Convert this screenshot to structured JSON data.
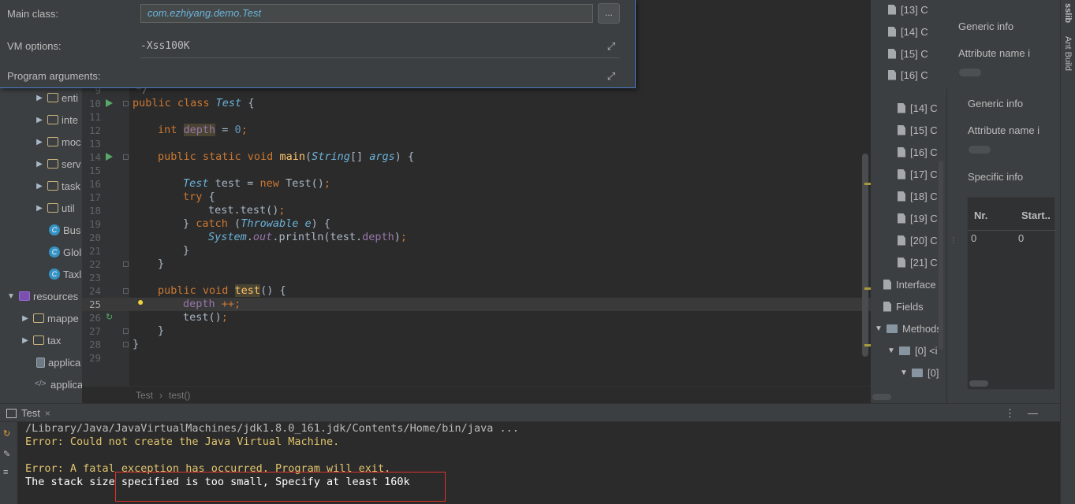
{
  "dialog": {
    "main_class_label": "Main class:",
    "main_class_value": "com.ezhiyang.demo.Test",
    "browse_label": "...",
    "vm_options_label": "VM options:",
    "vm_options_value": "-Xss100K",
    "program_args_label": "Program arguments:"
  },
  "project_tree": {
    "items": [
      {
        "label": "enti",
        "kind": "folder"
      },
      {
        "label": "inte",
        "kind": "folder"
      },
      {
        "label": "moc",
        "kind": "folder"
      },
      {
        "label": "serv",
        "kind": "folder"
      },
      {
        "label": "task",
        "kind": "folder"
      },
      {
        "label": "util",
        "kind": "folder"
      },
      {
        "label": "Bus",
        "kind": "class"
      },
      {
        "label": "Glol",
        "kind": "class"
      },
      {
        "label": "Taxl",
        "kind": "class"
      },
      {
        "label": "resources",
        "kind": "resources"
      },
      {
        "label": "mappe",
        "kind": "folder"
      },
      {
        "label": "tax",
        "kind": "folder"
      },
      {
        "label": "applica",
        "kind": "file"
      },
      {
        "label": "applica",
        "kind": "xml"
      }
    ]
  },
  "editor": {
    "line_numbers": [
      "10",
      "11",
      "12",
      "13",
      "14",
      "15",
      "16",
      "17",
      "18",
      "19",
      "20",
      "21",
      "22",
      "23",
      "24",
      "25",
      "26",
      "27",
      "28",
      "29"
    ],
    "current_line": "25",
    "partial_top_line": "9",
    "partial_top_text": "*/",
    "breadcrumb": [
      "Test",
      "test()"
    ],
    "breadcrumb_sep": "›"
  },
  "jclasslib": {
    "top_items": [
      "[13] C",
      "[14] C",
      "[15] C",
      "[16] C"
    ],
    "items": [
      "[14] C",
      "[15] C",
      "[16] C",
      "[17] C",
      "[18] C",
      "[19] C",
      "[20] C",
      "[21] C"
    ],
    "interfaces": "Interface",
    "fields": "Fields",
    "methods": "Methods",
    "method0": "[0] <i",
    "method0_child": "[0]",
    "generic_info_top": "Generic info",
    "attribute_name_top": "Attribute name i",
    "generic_info": "Generic info",
    "attribute_name": "Attribute name i",
    "specific_info": "Specific info",
    "table_headers": [
      "Nr.",
      "Start.."
    ],
    "table_row": [
      "0",
      "0"
    ]
  },
  "side_strip": {
    "labels": [
      "sslib",
      "Ant Build"
    ]
  },
  "console": {
    "tab_label": "Test",
    "close": "×",
    "lines": [
      "/Library/Java/JavaVirtualMachines/jdk1.8.0_161.jdk/Contents/Home/bin/java ...",
      "Error: Could not create the Java Virtual Machine.",
      "",
      "Error: A fatal exception has occurred. Program will exit.",
      "The stack size specified is too small, Specify at least 160k"
    ],
    "menu_icon": "⋮",
    "minimize_icon": "—"
  },
  "colors": {
    "keyword": "#cc7832",
    "error_text": "#e0c46c",
    "highlight_box": "#e0302a",
    "dialog_border": "#4a7ac9"
  }
}
